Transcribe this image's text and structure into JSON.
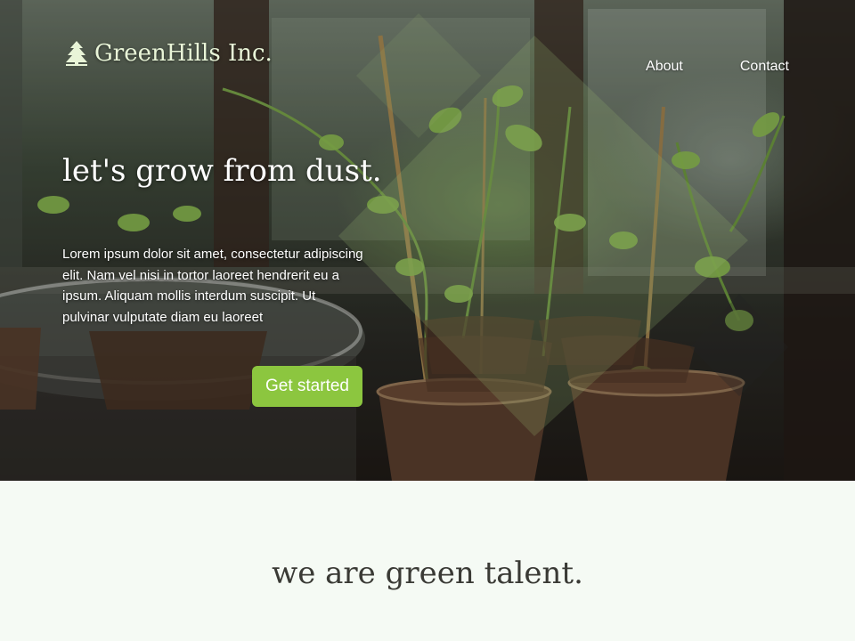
{
  "brand": {
    "name": "GreenHills Inc.",
    "logo_icon": "pine-tree-icon"
  },
  "nav": {
    "about_label": "About",
    "contact_label": "Contact"
  },
  "hero": {
    "title": "let's grow from dust.",
    "body": "Lorem ipsum dolor sit amet, consectetur adipiscing elit. Nam vel nisi in tortor laoreet hendrerit eu a ipsum. Aliquam mollis interdum suscipit. Ut pulvinar vulputate diam eu laoreet",
    "cta_label": "Get started",
    "background_image": "seedlings in peat pots on a windowsill"
  },
  "section": {
    "title": "we are green talent."
  },
  "colors": {
    "accent": "#8cc63f",
    "page_background": "#f5faf4",
    "heading_text": "#3a3a35",
    "logo_text": "#e9f5d8",
    "diamond_overlay": "#b8d98a"
  }
}
